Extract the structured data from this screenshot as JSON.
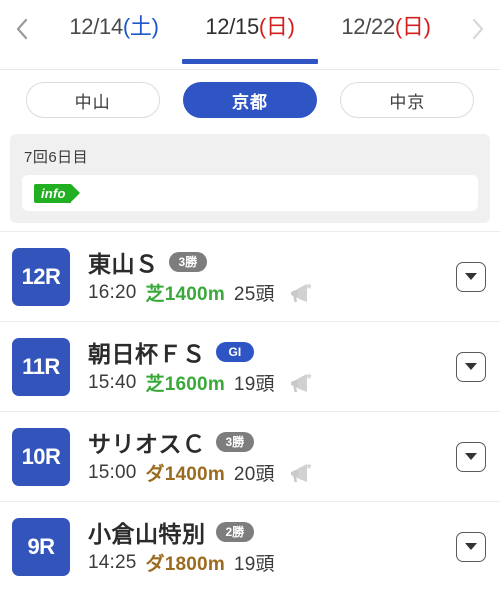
{
  "header": {
    "prev_arrow_icon": "chevron-left-icon",
    "next_arrow_icon": "chevron-right-icon",
    "date_tabs": [
      {
        "date": "12/14",
        "dow": "(土)",
        "dow_type": "sat",
        "selected": false
      },
      {
        "date": "12/15",
        "dow": "(日)",
        "dow_type": "sun",
        "selected": true
      },
      {
        "date": "12/22",
        "dow": "(日)",
        "dow_type": "sun",
        "selected": false
      }
    ]
  },
  "venues": [
    {
      "label": "中山",
      "active": false
    },
    {
      "label": "京都",
      "active": true
    },
    {
      "label": "中京",
      "active": false
    }
  ],
  "info_panel": {
    "day_label": "7回6日目",
    "info_tag_label": "info",
    "info_message": ""
  },
  "races": [
    {
      "number": "12R",
      "title": "東山Ｓ",
      "grade": "3勝",
      "grade_style": "gray",
      "time": "16:20",
      "course": "芝1400m",
      "surface": "turf",
      "horses": "25頭",
      "has_announcement": true,
      "expand_icon": "chevron-down-icon"
    },
    {
      "number": "11R",
      "title": "朝日杯ＦＳ",
      "grade": "GI",
      "grade_style": "blue",
      "time": "15:40",
      "course": "芝1600m",
      "surface": "turf",
      "horses": "19頭",
      "has_announcement": true,
      "expand_icon": "chevron-down-icon"
    },
    {
      "number": "10R",
      "title": "サリオスＣ",
      "grade": "3勝",
      "grade_style": "gray",
      "time": "15:00",
      "course": "ダ1400m",
      "surface": "dirt",
      "horses": "20頭",
      "has_announcement": true,
      "expand_icon": "chevron-down-icon"
    },
    {
      "number": "9R",
      "title": "小倉山特別",
      "grade": "2勝",
      "grade_style": "gray",
      "time": "14:25",
      "course": "ダ1800m",
      "surface": "dirt",
      "horses": "19頭",
      "has_announcement": false,
      "expand_icon": "chevron-down-icon"
    }
  ],
  "colors": {
    "accent_blue": "#2f55c5",
    "race_badge_blue": "#3355bb",
    "turf_green": "#3aa93a",
    "dirt_brown": "#9b6b1f",
    "info_green": "#22b022",
    "sunday_red": "#d22020",
    "saturday_blue": "#1f58c9"
  }
}
